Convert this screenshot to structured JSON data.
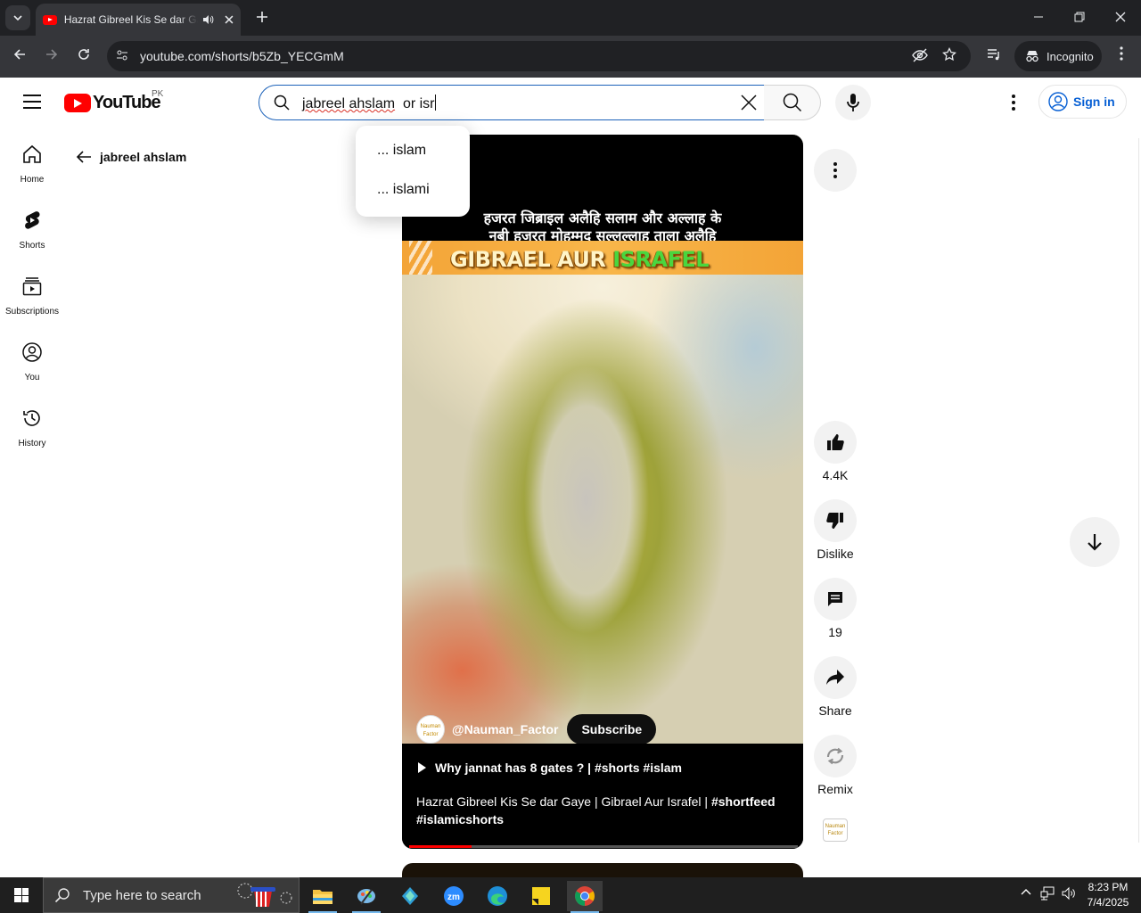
{
  "browser": {
    "tab_title": "Hazrat Gibreel Kis Se dar Gaye | Gibrael Aur Israfel",
    "url": "youtube.com/shorts/b5Zb_YECGmM",
    "incognito_label": "Incognito"
  },
  "masthead": {
    "logo_text": "YouTube",
    "country": "PK",
    "search_misspelled": "jabreel ahslam",
    "search_rest": "  or isr",
    "signin_label": "Sign in"
  },
  "suggestions": [
    {
      "label": "... islam"
    },
    {
      "label": "... islami"
    }
  ],
  "guide": [
    {
      "label": "Home",
      "icon": "home-icon"
    },
    {
      "label": "Shorts",
      "icon": "shorts-icon"
    },
    {
      "label": "Subscriptions",
      "icon": "subscriptions-icon"
    },
    {
      "label": "You",
      "icon": "you-icon"
    },
    {
      "label": "History",
      "icon": "history-icon"
    }
  ],
  "back": {
    "label": "jabreel ahslam"
  },
  "video": {
    "caption_line1": "हजरत जिब्राइल अलैहि सलाम और अल्लाह के",
    "caption_line2": "नबी हजरत मोहम्मद सल्लल्लाहु ताला अलैहि",
    "banner_part1": "GIBRAEL AUR ",
    "banner_part2": "ISRAFEL",
    "channel_name": "@Nauman_Factor",
    "channel_avatar_text": "Nauman Factor",
    "subscribe_label": "Subscribe",
    "related_title": "Why jannat has 8 gates ? | #shorts #islam",
    "description_plain": "Hazrat Gibreel Kis Se dar Gaye | Gibrael Aur Israfel | ",
    "description_tag1": "#shortfeed",
    "description_tag2": "#islamicshorts",
    "progress": 0.16
  },
  "actions": {
    "likes": "4.4K",
    "dislike_label": "Dislike",
    "comments": "19",
    "share_label": "Share",
    "remix_label": "Remix",
    "remix_thumb_text": "Nauman Factor"
  },
  "taskbar": {
    "search_placeholder": "Type here to search",
    "time": "8:23 PM",
    "date": "7/4/2025"
  },
  "colors": {
    "yt_red": "#ff0000",
    "link_blue": "#065fd4",
    "banner_orange": "#f3a437",
    "banner_green": "#4ad63f"
  }
}
